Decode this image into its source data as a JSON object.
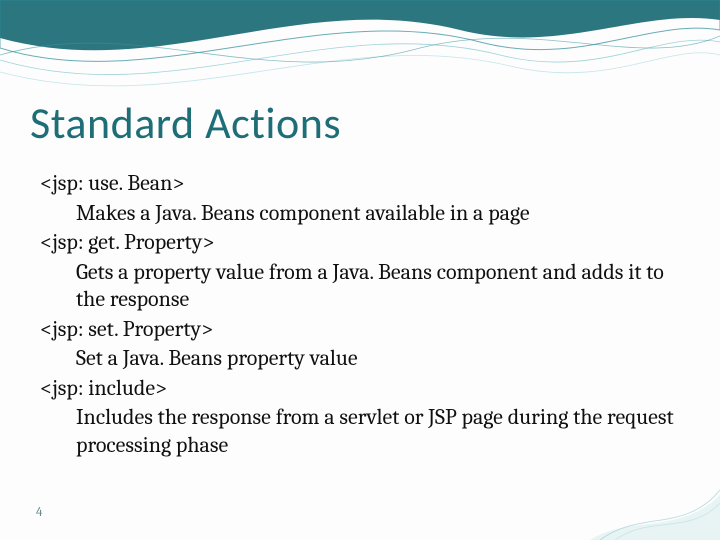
{
  "title": "Standard Actions",
  "items": [
    {
      "tag": "<jsp: use. Bean>",
      "desc": "Makes a Java. Beans component available in a page"
    },
    {
      "tag": "<jsp: get. Property>",
      "desc": "Gets a property value from a Java. Beans component and adds it to the response"
    },
    {
      "tag": "<jsp: set. Property>",
      "desc": "Set a Java. Beans property value"
    },
    {
      "tag": "<jsp: include>",
      "desc": "Includes the response from a servlet or JSP page during the request processing phase"
    }
  ],
  "page_number": "4",
  "colors": {
    "accent": "#1e6e78"
  }
}
